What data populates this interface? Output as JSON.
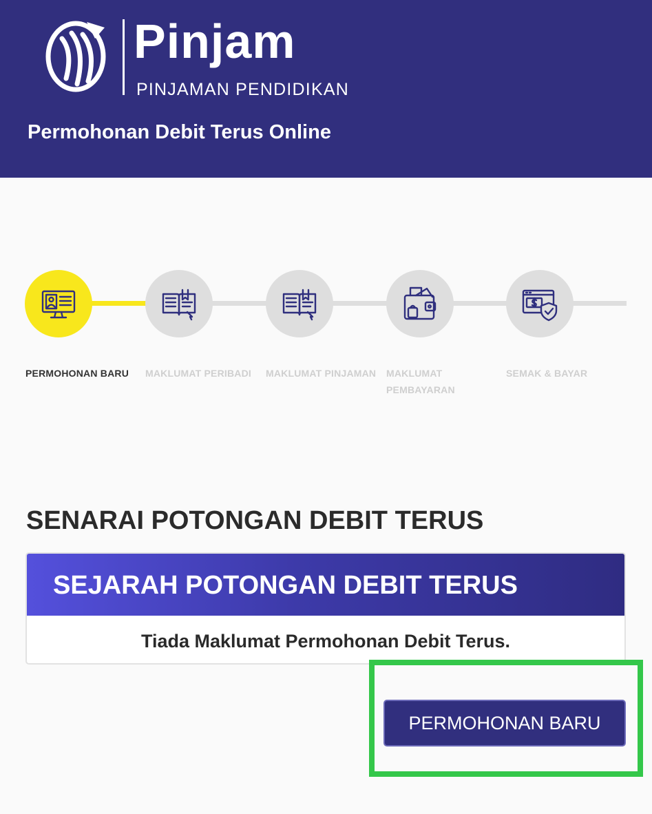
{
  "header": {
    "brand": "Pinjam",
    "brand_sub": "PINJAMAN PENDIDIKAN",
    "title": "Permohonan Debit Terus Online"
  },
  "stepper": {
    "current_step": 1,
    "steps": [
      {
        "label": "PERMOHONAN BARU",
        "icon": "computer-profile-icon",
        "active": true
      },
      {
        "label": "MAKLUMAT PERIBADI",
        "icon": "open-book-icon",
        "active": false
      },
      {
        "label": "MAKLUMAT PINJAMAN",
        "icon": "open-book-icon",
        "active": false
      },
      {
        "label_line1": "MAKLUMAT",
        "label_line2": "PEMBAYARAN",
        "icon": "wallet-icon",
        "active": false
      },
      {
        "label": "SEMAK & BAYAR",
        "icon": "payment-shield-icon",
        "active": false
      }
    ]
  },
  "main": {
    "section_title": "SENARAI POTONGAN DEBIT TERUS",
    "card_title": "SEJARAH POTONGAN DEBIT TERUS",
    "empty_message": "Tiada Maklumat Permohonan Debit Terus.",
    "new_button_label": "PERMOHONAN BARU"
  },
  "colors": {
    "brand": "#312f7e",
    "active_step": "#f8e71c",
    "inactive_step": "#dedede",
    "highlight": "#34c74a"
  }
}
